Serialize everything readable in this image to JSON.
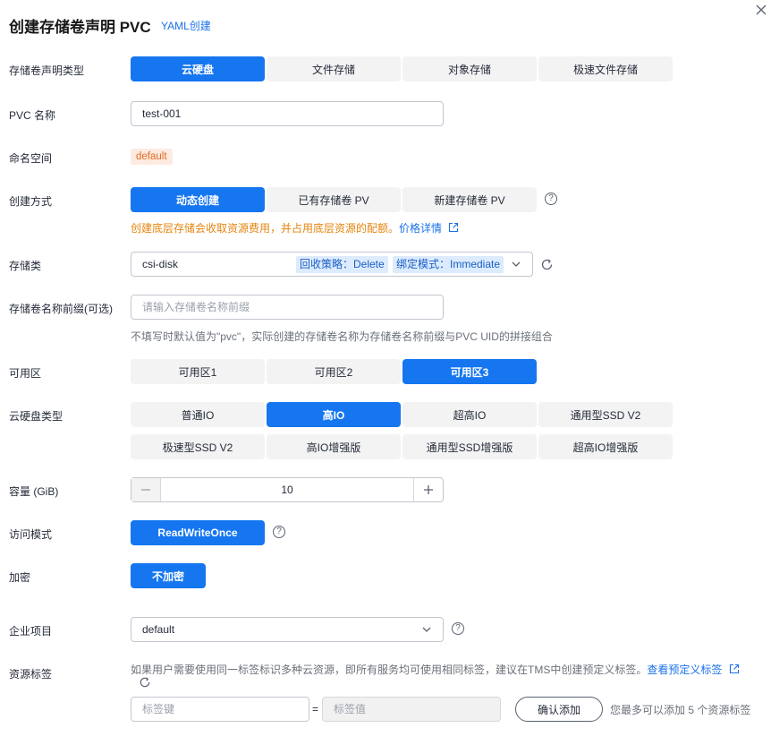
{
  "header": {
    "title": "创建存储卷声明 PVC",
    "yaml_link": "YAML创建"
  },
  "pvc_type": {
    "label": "存储卷声明类型",
    "options": [
      "云硬盘",
      "文件存储",
      "对象存储",
      "极速文件存储"
    ],
    "selected": "云硬盘"
  },
  "pvc_name": {
    "label": "PVC 名称",
    "value": "test-001"
  },
  "namespace": {
    "label": "命名空间",
    "value": "default"
  },
  "create_mode": {
    "label": "创建方式",
    "options": [
      "动态创建",
      "已有存储卷 PV",
      "新建存储卷 PV"
    ],
    "selected": "动态创建",
    "hint": "创建底层存储会收取资源费用，并占用底层资源的配额。",
    "hint_link": "价格详情"
  },
  "storage_class": {
    "label": "存储类",
    "value": "csi-disk",
    "pill_reclaim": "回收策略：Delete",
    "pill_binding": "绑定模式：Immediate"
  },
  "volume_prefix": {
    "label": "存储卷名称前缀(可选)",
    "placeholder": "请输入存储卷名称前缀",
    "hint": "不填写时默认值为\"pvc\"，实际创建的存储卷名称为存储卷名称前缀与PVC UID的拼接组合"
  },
  "zone": {
    "label": "可用区",
    "options": [
      "可用区1",
      "可用区2",
      "可用区3"
    ],
    "selected": "可用区3"
  },
  "disk_type": {
    "label": "云硬盘类型",
    "options": [
      "普通IO",
      "高IO",
      "超高IO",
      "通用型SSD V2",
      "极速型SSD V2",
      "高IO增强版",
      "通用型SSD增强版",
      "超高IO增强版"
    ],
    "selected": "高IO"
  },
  "capacity": {
    "label": "容量 (GiB)",
    "value": "10"
  },
  "access_mode": {
    "label": "访问模式",
    "value": "ReadWriteOnce"
  },
  "encryption": {
    "label": "加密",
    "value": "不加密"
  },
  "enterprise_project": {
    "label": "企业项目",
    "value": "default"
  },
  "resource_tags": {
    "label": "资源标签",
    "hint": "如果用户需要使用同一标签标识多种云资源，即所有服务均可使用相同标签，建议在TMS中创建预定义标签。",
    "hint_link": "查看预定义标签",
    "key_placeholder": "标签键",
    "equals": "=",
    "value_placeholder": "标签值",
    "add_button": "确认添加",
    "limit_text": "您最多可以添加 5 个资源标签"
  },
  "colors": {
    "primary": "#1576f0",
    "link": "#1a72e8",
    "warning": "#e4850f",
    "segment_bg": "#f3f3f3"
  }
}
